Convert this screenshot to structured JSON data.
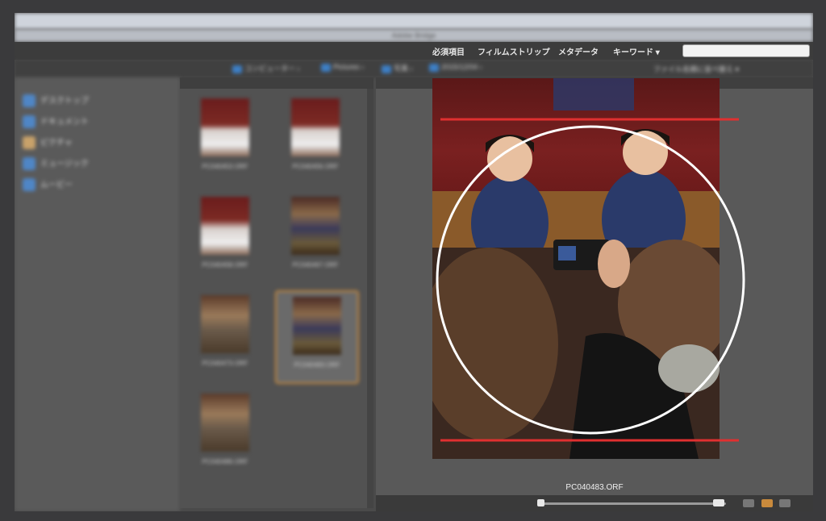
{
  "window": {
    "title": "Adobe Bridge"
  },
  "workspace_tabs": [
    "必須項目",
    "フィルムストリップ",
    "メタデータ",
    "キーワード ▾"
  ],
  "search": {
    "placeholder": ""
  },
  "breadcrumbs": [
    "コンピューター",
    "Pictures",
    "写真",
    "2015/12/04"
  ],
  "sort": {
    "label": "ファイル名順に並べ替え ▾"
  },
  "sidebar": {
    "items": [
      {
        "label": "デスクトップ"
      },
      {
        "label": "ドキュメント"
      },
      {
        "label": "ピクチャ"
      },
      {
        "label": "ミュージック"
      },
      {
        "label": "ムービー"
      }
    ]
  },
  "thumbnails": [
    {
      "label": "PC040453.ORF",
      "selected": false
    },
    {
      "label": "PC040456.ORF",
      "selected": false
    },
    {
      "label": "PC040458.ORF",
      "selected": false
    },
    {
      "label": "PC040467.ORF",
      "selected": false
    },
    {
      "label": "PC040473.ORF",
      "selected": false
    },
    {
      "label": "PC040483.ORF",
      "selected": true
    },
    {
      "label": "PC040486.ORF",
      "selected": false
    }
  ],
  "preview": {
    "filename": "PC040483.ORF"
  },
  "annotation": {
    "line_color": "#e03030",
    "circle_color": "#ffffff"
  },
  "colors": {
    "selection": "#c98a3c",
    "folder_icon": "#3d7fc6"
  }
}
